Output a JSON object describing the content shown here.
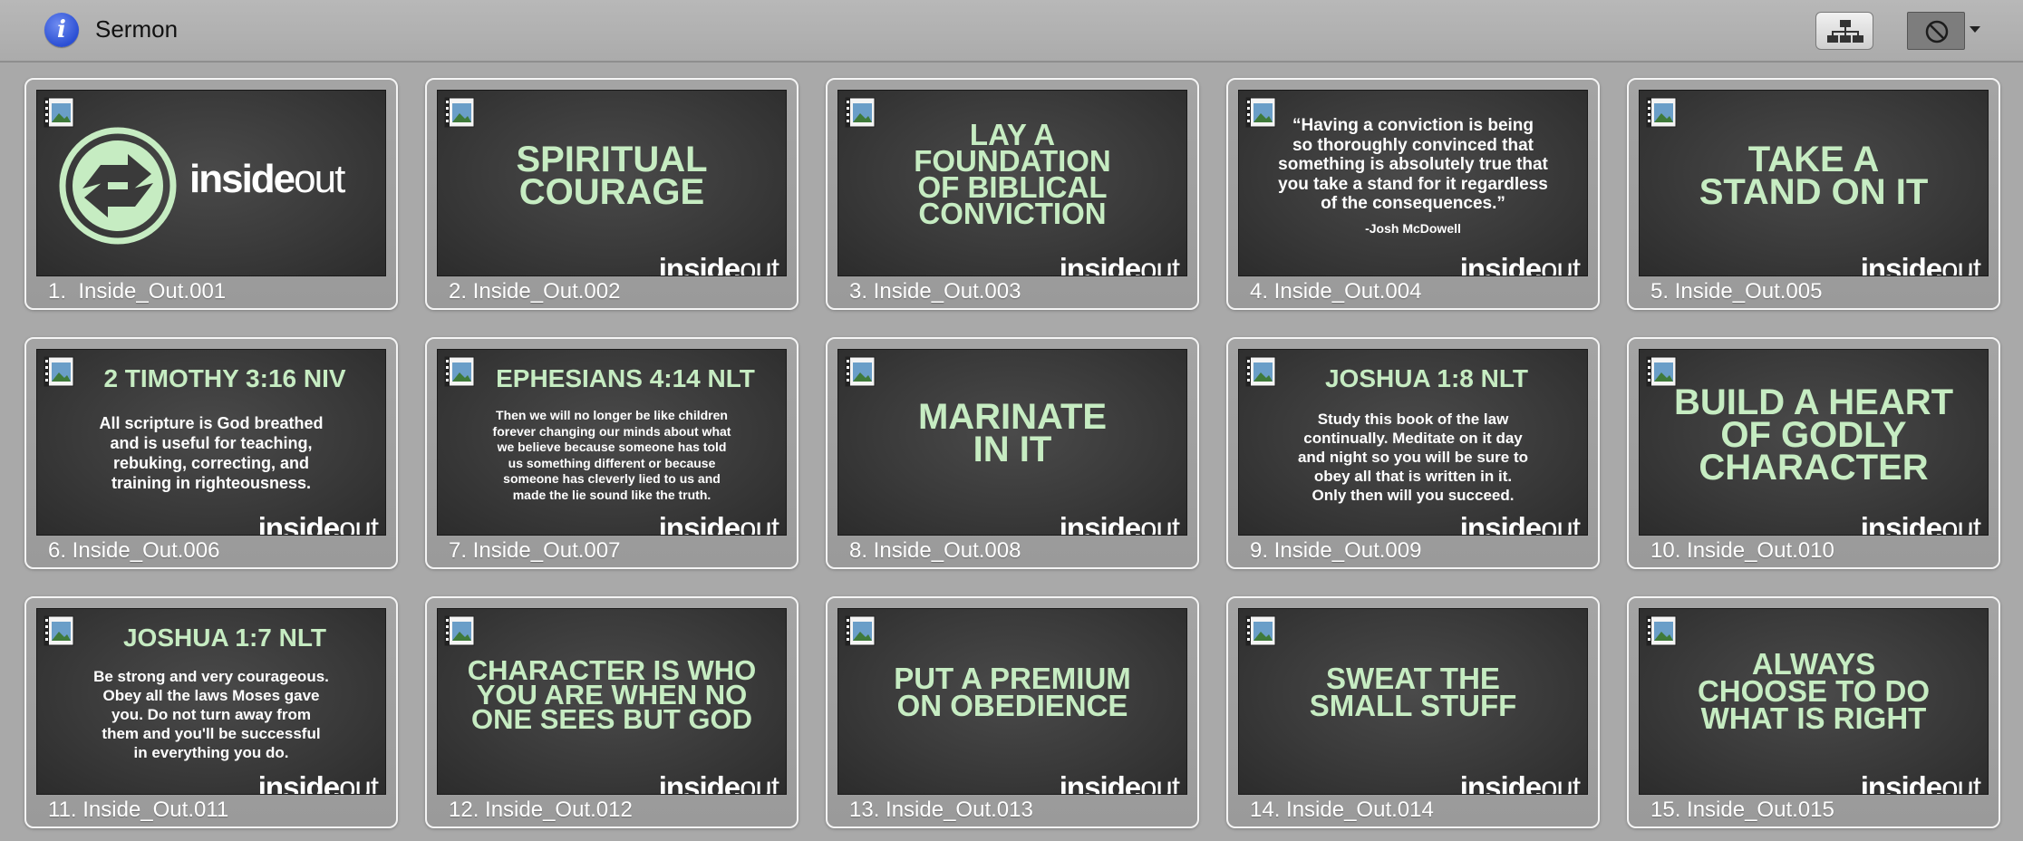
{
  "header": {
    "title": "Sermon",
    "info_icon": "info-icon",
    "tree_icon": "hierarchy-icon",
    "disable_icon": "no-entry-icon"
  },
  "colors": {
    "slide_title": "#c6ecc2",
    "slide_bg": "#3a3a3a",
    "window_bg": "#a9a9a9"
  },
  "slides": [
    {
      "label": "1.  Inside_Out.001",
      "kind": "logo",
      "logo_strong": "inside",
      "logo_light": "out"
    },
    {
      "label": "2. Inside_Out.002",
      "kind": "title",
      "title": "SPIRITUAL\nCOURAGE",
      "logo_strong": "inside",
      "logo_light": "out"
    },
    {
      "label": "3. Inside_Out.003",
      "kind": "title",
      "title": "LAY A\nFOUNDATION\nOF BIBLICAL\nCONVICTION",
      "logo_strong": "inside",
      "logo_light": "out"
    },
    {
      "label": "4. Inside_Out.004",
      "kind": "quote",
      "body": "“Having a conviction is being\nso thoroughly convinced that\nsomething is absolutely true that\nyou take a stand for it regardless\nof the consequences.”",
      "attribution": "-Josh McDowell",
      "logo_strong": "inside",
      "logo_light": "out"
    },
    {
      "label": "5. Inside_Out.005",
      "kind": "title",
      "title": "TAKE A\nSTAND ON IT",
      "logo_strong": "inside",
      "logo_light": "out"
    },
    {
      "label": "6. Inside_Out.006",
      "kind": "verse",
      "title": "2 TIMOTHY 3:16 NIV",
      "body": "All scripture is God breathed\nand is useful for teaching,\nrebuking, correcting, and\ntraining in righteousness.",
      "logo_strong": "inside",
      "logo_light": "out"
    },
    {
      "label": "7. Inside_Out.007",
      "kind": "verse",
      "title": "EPHESIANS 4:14 NLT",
      "body": "Then we will no longer be like children\nforever changing our minds about what\nwe believe because someone has told\nus something different or because\nsomeone has cleverly lied to us and\nmade the lie sound like the truth.",
      "logo_strong": "inside",
      "logo_light": "out"
    },
    {
      "label": "8. Inside_Out.008",
      "kind": "title",
      "title": "MARINATE\nIN IT",
      "logo_strong": "inside",
      "logo_light": "out"
    },
    {
      "label": "9. Inside_Out.009",
      "kind": "verse",
      "title": "JOSHUA 1:8 NLT",
      "body": "Study this book of the law\ncontinually.  Meditate on it day\nand night so you will be sure to\nobey all that is written in it.\nOnly then will you succeed.",
      "logo_strong": "inside",
      "logo_light": "out"
    },
    {
      "label": "10. Inside_Out.010",
      "kind": "title",
      "title": "BUILD A HEART\nOF GODLY\nCHARACTER",
      "logo_strong": "inside",
      "logo_light": "out"
    },
    {
      "label": "11. Inside_Out.011",
      "kind": "verse",
      "title": "JOSHUA 1:7 NLT",
      "body": "Be strong and very courageous.\nObey all the laws Moses gave\nyou.  Do not turn away from\nthem and you'll be successful\nin everything you do.",
      "logo_strong": "inside",
      "logo_light": "out"
    },
    {
      "label": "12. Inside_Out.012",
      "kind": "title",
      "title": "CHARACTER IS WHO\nYOU ARE WHEN NO\nONE SEES BUT GOD",
      "logo_strong": "inside",
      "logo_light": "out"
    },
    {
      "label": "13. Inside_Out.013",
      "kind": "title",
      "title": "PUT A PREMIUM\nON OBEDIENCE",
      "logo_strong": "inside",
      "logo_light": "out"
    },
    {
      "label": "14. Inside_Out.014",
      "kind": "title",
      "title": "SWEAT THE\nSMALL STUFF",
      "logo_strong": "inside",
      "logo_light": "out"
    },
    {
      "label": "15. Inside_Out.015",
      "kind": "title",
      "title": "ALWAYS\nCHOOSE TO DO\nWHAT IS RIGHT",
      "logo_strong": "inside",
      "logo_light": "out"
    }
  ]
}
